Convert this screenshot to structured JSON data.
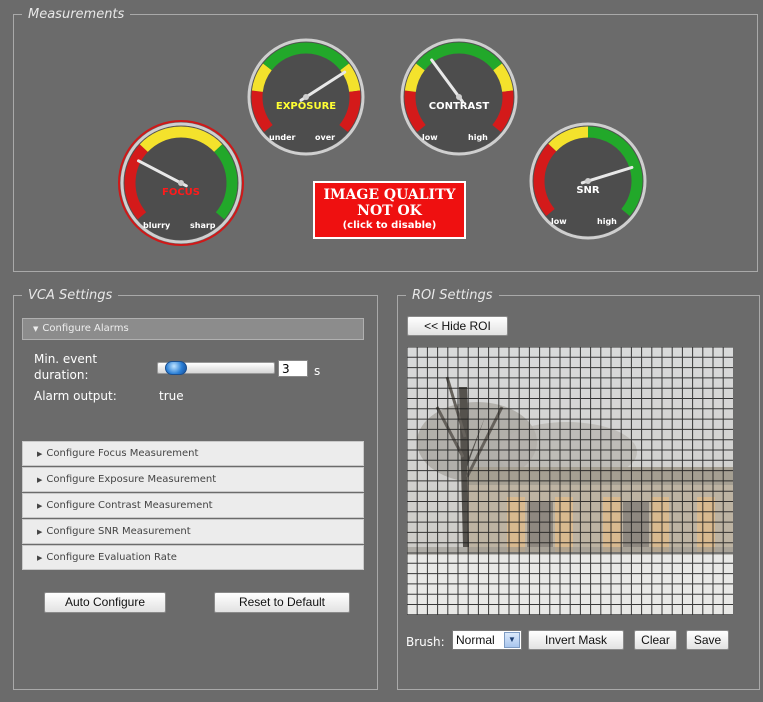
{
  "measurements": {
    "legend": "Measurements",
    "gauges": [
      {
        "id": "focus",
        "name": "FOCUS",
        "low_label": "blurry",
        "high_label": "sharp",
        "level": 0.26,
        "name_color": "#ff1a1a",
        "alarm": true
      },
      {
        "id": "exposure",
        "name": "EXPOSURE",
        "low_label": "under",
        "high_label": "over",
        "level": 0.72,
        "name_color": "#ffff33",
        "alarm": false
      },
      {
        "id": "contrast",
        "name": "CONTRAST",
        "low_label": "low",
        "high_label": "high",
        "level": 0.36,
        "name_color": "#ffffff",
        "alarm": false
      },
      {
        "id": "snr",
        "name": "SNR",
        "low_label": "low",
        "high_label": "high",
        "level": 0.78,
        "name_color": "#ffffff",
        "alarm": false
      }
    ],
    "status": {
      "line1": "IMAGE QUALITY",
      "line2": "NOT OK",
      "line3": "(click to disable)"
    }
  },
  "vca": {
    "legend": "VCA Settings",
    "open_section": "Configure Alarms",
    "min_event_label_1": "Min. event",
    "min_event_label_2": "duration:",
    "min_event_value": "3",
    "min_event_unit": "s",
    "min_event_slider_level": 0.05,
    "alarm_output_label": "Alarm output:",
    "alarm_output_value": "true",
    "sections": [
      "Configure Focus Measurement",
      "Configure Exposure Measurement",
      "Configure Contrast Measurement",
      "Configure SNR Measurement",
      "Configure Evaluation Rate"
    ],
    "auto_configure": "Auto Configure",
    "reset_default": "Reset to Default"
  },
  "roi": {
    "legend": "ROI Settings",
    "hide_roi": "<< Hide ROI",
    "brush_label": "Brush:",
    "brush_value": "Normal",
    "invert_mask": "Invert Mask",
    "clear": "Clear",
    "save": "Save"
  },
  "colors": {
    "gauge_red": "#d41a1a",
    "gauge_yellow": "#f4e22c",
    "gauge_green": "#22a82a",
    "alarm": "#ef1010"
  }
}
